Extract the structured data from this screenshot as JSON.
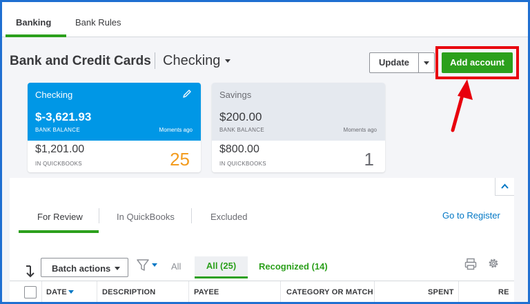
{
  "top_tabs": [
    {
      "label": "Banking",
      "active": true
    },
    {
      "label": "Bank Rules",
      "active": false
    }
  ],
  "header": {
    "title": "Bank and Credit Cards",
    "selected_account": "Checking",
    "update_label": "Update",
    "add_account_label": "Add account"
  },
  "cards": [
    {
      "name": "Checking",
      "bank_balance": "$-3,621.93",
      "bank_balance_label": "BANK BALANCE",
      "updated": "Moments ago",
      "qb_balance": "$1,201.00",
      "qb_label": "IN QUICKBOOKS",
      "count": "25",
      "selected": true
    },
    {
      "name": "Savings",
      "bank_balance": "$200.00",
      "bank_balance_label": "BANK BALANCE",
      "updated": "Moments ago",
      "qb_balance": "$800.00",
      "qb_label": "IN QUICKBOOKS",
      "count": "1",
      "selected": false
    }
  ],
  "sub_tabs": [
    {
      "label": "For Review",
      "active": true
    },
    {
      "label": "In QuickBooks",
      "active": false
    },
    {
      "label": "Excluded",
      "active": false
    }
  ],
  "go_to_register": "Go to Register",
  "toolbar": {
    "batch_actions": "Batch actions",
    "filter_all": "All",
    "filter_all_count": "All (25)",
    "filter_recognized": "Recognized (14)"
  },
  "table": {
    "columns": [
      "DATE",
      "DESCRIPTION",
      "PAYEE",
      "CATEGORY OR MATCH",
      "SPENT",
      "RE"
    ]
  },
  "colors": {
    "accent_green": "#2ca01c",
    "selected_card": "#0097e6",
    "highlight_red": "#e8000d",
    "link_blue": "#0077c5",
    "count_orange": "#f39c1f"
  }
}
